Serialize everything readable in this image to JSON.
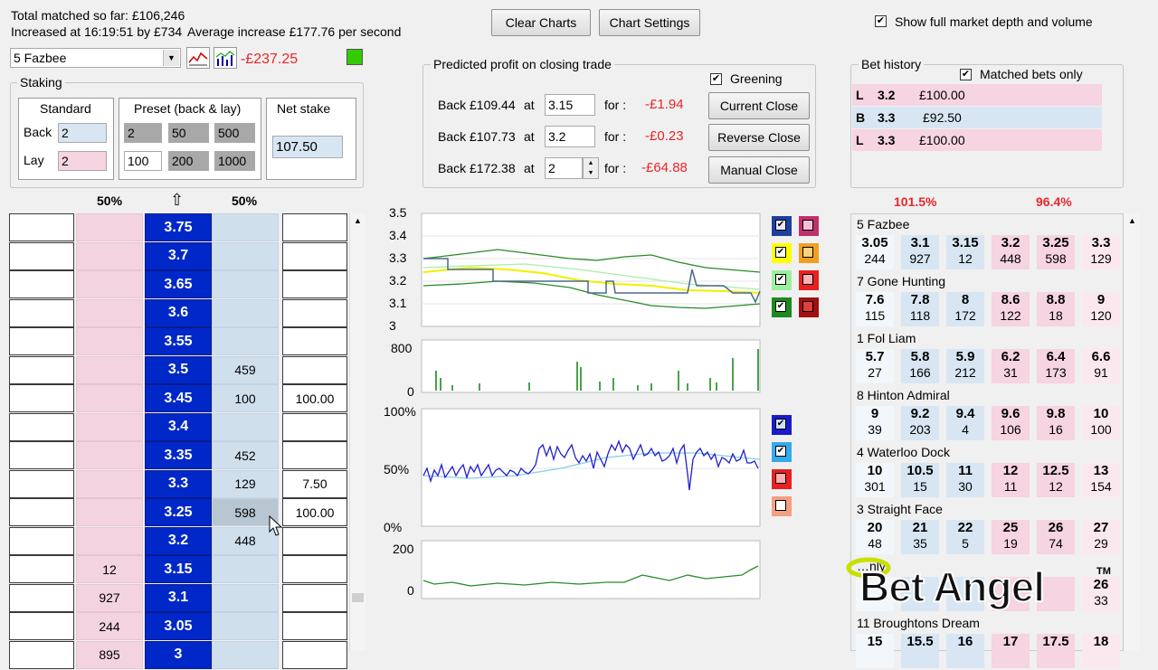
{
  "header": {
    "total_matched": "Total matched so far: £106,246",
    "increased": "Increased at 16:19:51 by £734",
    "average": "Average increase £177.76 per second",
    "clear_charts": "Clear Charts",
    "chart_settings": "Chart Settings",
    "show_depth_label": "Show full market depth and volume",
    "show_depth_checked": true
  },
  "selection": {
    "runner": "5 Fazbee",
    "pl": "-£237.25"
  },
  "staking": {
    "title": "Staking",
    "standard_label": "Standard",
    "preset_label": "Preset (back & lay)",
    "net_label": "Net stake",
    "back_label": "Back",
    "lay_label": "Lay",
    "back_value": "2",
    "lay_value": "2",
    "preset_back": [
      "2",
      "50",
      "500"
    ],
    "preset_lay": [
      "100",
      "200",
      "1000"
    ],
    "net_value": "107.50"
  },
  "predicted": {
    "title": "Predicted profit on closing trade",
    "greening_label": "Greening",
    "greening_checked": true,
    "rows": [
      {
        "label": "Back £109.44",
        "at": "at",
        "odds": "3.15",
        "for": "for :",
        "profit": "-£1.94",
        "button": "Current Close"
      },
      {
        "label": "Back £107.73",
        "at": "at",
        "odds": "3.2",
        "for": "for :",
        "profit": "-£0.23",
        "button": "Reverse Close"
      },
      {
        "label": "Back £172.38",
        "at": "at",
        "odds": "2",
        "for": "for :",
        "profit": "-£64.88",
        "button": "Manual Close"
      }
    ]
  },
  "bet_history": {
    "title": "Bet history",
    "matched_only_label": "Matched bets only",
    "matched_only_checked": true,
    "rows": [
      {
        "type": "L",
        "odds": "3.2",
        "stake": "£100.00"
      },
      {
        "type": "B",
        "odds": "3.3",
        "stake": "£92.50"
      },
      {
        "type": "L",
        "odds": "3.3",
        "stake": "£100.00"
      }
    ]
  },
  "ladder": {
    "lay_pct": "50%",
    "back_pct": "50%",
    "rows": [
      {
        "price": "3.75",
        "lay": "",
        "back": "",
        "right": ""
      },
      {
        "price": "3.7",
        "lay": "",
        "back": "",
        "right": ""
      },
      {
        "price": "3.65",
        "lay": "",
        "back": "",
        "right": ""
      },
      {
        "price": "3.6",
        "lay": "",
        "back": "",
        "right": ""
      },
      {
        "price": "3.55",
        "lay": "",
        "back": "",
        "right": ""
      },
      {
        "price": "3.5",
        "lay": "",
        "back": "459",
        "right": ""
      },
      {
        "price": "3.45",
        "lay": "",
        "back": "100",
        "right": "100.00"
      },
      {
        "price": "3.4",
        "lay": "",
        "back": "",
        "right": ""
      },
      {
        "price": "3.35",
        "lay": "",
        "back": "452",
        "right": ""
      },
      {
        "price": "3.3",
        "lay": "",
        "back": "129",
        "right": "7.50"
      },
      {
        "price": "3.25",
        "lay": "",
        "back": "598",
        "right": "100.00"
      },
      {
        "price": "3.2",
        "lay": "",
        "back": "448",
        "right": ""
      },
      {
        "price": "3.15",
        "lay": "12",
        "back": "",
        "right": ""
      },
      {
        "price": "3.1",
        "lay": "927",
        "back": "",
        "right": ""
      },
      {
        "price": "3.05",
        "lay": "244",
        "back": "",
        "right": ""
      },
      {
        "price": "3",
        "lay": "895",
        "back": "",
        "right": ""
      }
    ]
  },
  "charts": {
    "price_ticks": [
      "3.5",
      "3.4",
      "3.3",
      "3.2",
      "3.1",
      "3"
    ],
    "volume_ticks": [
      "800",
      "0"
    ],
    "pct_ticks": [
      "100%",
      "50%",
      "0%"
    ],
    "bottom_ticks": [
      "200",
      "0"
    ],
    "price_checkbox_colors": [
      "#1f3fa0",
      "#ffff00",
      "#9cf09c",
      "#1c8a1c"
    ],
    "price_swatch_colors": [
      "#c0306a",
      "#f0a020",
      "#e82020",
      "#a01010"
    ],
    "pct_checkbox_colors": [
      "#1a1acc",
      "#33aaee",
      "#e82020",
      "#f4a080"
    ],
    "pct_checked": [
      true,
      true,
      false,
      false
    ]
  },
  "markets": {
    "back_pct": "101.5%",
    "lay_pct": "96.4%",
    "runners": [
      {
        "name": "5 Fazbee",
        "prices": [
          "3.05",
          "3.1",
          "3.15",
          "3.2",
          "3.25",
          "3.3"
        ],
        "vols": [
          "244",
          "927",
          "12",
          "448",
          "598",
          "129"
        ]
      },
      {
        "name": "7 Gone Hunting",
        "prices": [
          "7.6",
          "7.8",
          "8",
          "8.6",
          "8.8",
          "9"
        ],
        "vols": [
          "115",
          "118",
          "172",
          "122",
          "18",
          "120"
        ]
      },
      {
        "name": "1 Fol Liam",
        "prices": [
          "5.7",
          "5.8",
          "5.9",
          "6.2",
          "6.4",
          "6.6"
        ],
        "vols": [
          "27",
          "166",
          "212",
          "31",
          "173",
          "91"
        ]
      },
      {
        "name": "8 Hinton Admiral",
        "prices": [
          "9",
          "9.2",
          "9.4",
          "9.6",
          "9.8",
          "10"
        ],
        "vols": [
          "39",
          "203",
          "4",
          "106",
          "16",
          "100"
        ]
      },
      {
        "name": "4 Waterloo Dock",
        "prices": [
          "10",
          "10.5",
          "11",
          "12",
          "12.5",
          "13"
        ],
        "vols": [
          "301",
          "15",
          "30",
          "11",
          "12",
          "154"
        ]
      },
      {
        "name": "3 Straight Face",
        "prices": [
          "20",
          "21",
          "22",
          "25",
          "26",
          "27"
        ],
        "vols": [
          "48",
          "35",
          "5",
          "19",
          "74",
          "29"
        ]
      },
      {
        "name": "…nly",
        "prices": [
          "",
          "",
          "",
          "",
          "",
          "26"
        ],
        "vols": [
          "",
          "",
          "",
          "",
          "",
          "33"
        ]
      },
      {
        "name": "11 Broughtons Dream",
        "prices": [
          "15",
          "15.5",
          "16",
          "17",
          "17.5",
          "18"
        ],
        "vols": [
          "",
          "",
          "",
          "",
          "",
          ""
        ]
      }
    ]
  },
  "watermark": {
    "brand": "Bet Angel",
    "tm": "TM"
  }
}
